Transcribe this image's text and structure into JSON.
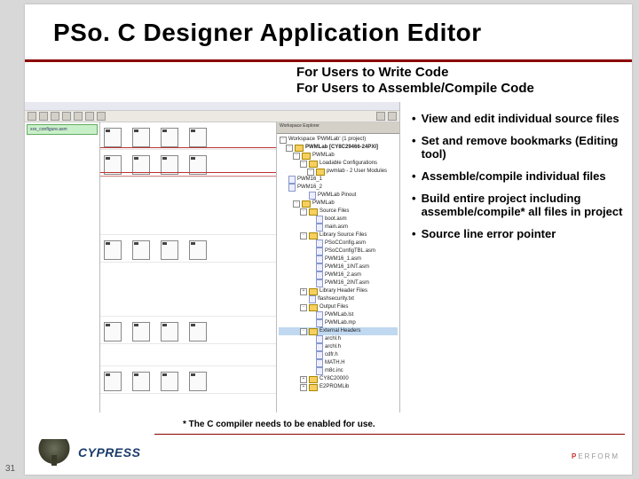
{
  "title": "PSo. C Designer Application Editor",
  "subtitle1": "For Users to Write Code",
  "subtitle2": "For Users to Assemble/Compile Code",
  "bullets": [
    "View and edit individual source files",
    "Set and remove bookmarks (Editing tool)",
    "Assemble/compile individual files",
    "Build entire project including assemble/compile* all files in project",
    "Source line error pointer"
  ],
  "footnote": "* The C compiler needs to be enabled for use.",
  "page_number": "31",
  "logo_text": "CYPRESS",
  "perform_text": "ERFORM",
  "screenshot": {
    "src_tabs": [
      "xxx_configure.asm"
    ],
    "explorer_title": "Workspace Explorer",
    "project_label": "Workspace 'PWMLab' (1 project)",
    "project_name": "PWMLab [CY8C29466-24PXI]",
    "tree": [
      {
        "d": 1,
        "t": "PWMLab",
        "k": "fold",
        "open": "-"
      },
      {
        "d": 2,
        "t": "Loadable Configurations",
        "k": "fold",
        "open": "-"
      },
      {
        "d": 3,
        "t": "pwmlab - 2 User Modules",
        "k": "fold",
        "open": "-"
      },
      {
        "d": 4,
        "t": "PWM16_1",
        "k": "file"
      },
      {
        "d": 4,
        "t": "PWM16_2",
        "k": "file"
      },
      {
        "d": 2,
        "t": "PWMLab  Pinout",
        "k": "file"
      },
      {
        "d": 1,
        "t": "PWMLab",
        "k": "fold",
        "open": "-"
      },
      {
        "d": 2,
        "t": "Source Files",
        "k": "fold",
        "open": "-"
      },
      {
        "d": 3,
        "t": "boot.asm",
        "k": "file"
      },
      {
        "d": 3,
        "t": "main.asm",
        "k": "file"
      },
      {
        "d": 2,
        "t": "Library Source Files",
        "k": "fold",
        "open": "-"
      },
      {
        "d": 3,
        "t": "PSoCConfig.asm",
        "k": "file"
      },
      {
        "d": 3,
        "t": "PSoCConfigTBL.asm",
        "k": "file"
      },
      {
        "d": 3,
        "t": "PWM16_1.asm",
        "k": "file"
      },
      {
        "d": 3,
        "t": "PWM16_1INT.asm",
        "k": "file"
      },
      {
        "d": 3,
        "t": "PWM16_2.asm",
        "k": "file"
      },
      {
        "d": 3,
        "t": "PWM16_2INT.asm",
        "k": "file"
      },
      {
        "d": 2,
        "t": "Library Header Files",
        "k": "fold",
        "open": "+"
      },
      {
        "d": 2,
        "t": "flashsecurity.txt",
        "k": "file"
      },
      {
        "d": 2,
        "t": "Output Files",
        "k": "fold",
        "open": "-"
      },
      {
        "d": 3,
        "t": "PWMLab.lst",
        "k": "file"
      },
      {
        "d": 3,
        "t": "PWMLab.mp",
        "k": "file"
      },
      {
        "d": 2,
        "t": "External Headers",
        "k": "fold",
        "open": "-",
        "sel": true
      },
      {
        "d": 3,
        "t": "archl.h",
        "k": "file"
      },
      {
        "d": 3,
        "t": "archl.h",
        "k": "file"
      },
      {
        "d": 3,
        "t": "cdfr.h",
        "k": "file"
      },
      {
        "d": 3,
        "t": "MATH.H",
        "k": "file"
      },
      {
        "d": 3,
        "t": "m8c.inc",
        "k": "file"
      },
      {
        "d": 2,
        "t": "CY8C20000",
        "k": "fold",
        "open": "+"
      },
      {
        "d": 2,
        "t": "E2PROMLib",
        "k": "fold",
        "open": "+"
      }
    ]
  }
}
